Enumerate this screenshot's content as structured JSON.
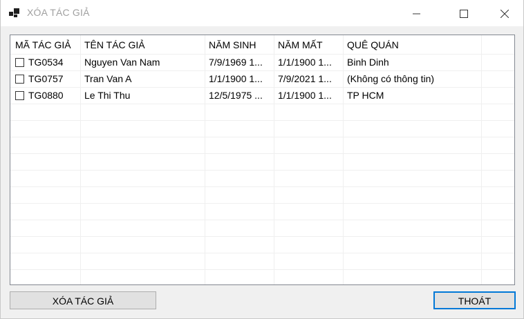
{
  "window": {
    "title": "XÓA TÁC GIẢ"
  },
  "table": {
    "headers": [
      "MÃ TÁC GIẢ",
      "TÊN TÁC GIẢ",
      "NĂM SINH",
      "NĂM MẤT",
      "QUÊ QUÁN"
    ],
    "rows": [
      {
        "checked": false,
        "id": "TG0534",
        "name": "Nguyen Van Nam",
        "birth": "7/9/1969 1...",
        "death": "1/1/1900 1...",
        "hometown": "Binh Dinh"
      },
      {
        "checked": false,
        "id": "TG0757",
        "name": "Tran Van A",
        "birth": "1/1/1900 1...",
        "death": "7/9/2021 1...",
        "hometown": "(Không có thông tin)"
      },
      {
        "checked": false,
        "id": "TG0880",
        "name": "Le Thi Thu",
        "birth": "12/5/1975 ...",
        "death": "1/1/1900 1...",
        "hometown": "TP HCM"
      }
    ]
  },
  "buttons": {
    "delete_label": "XÓA TÁC GIẢ",
    "exit_label": "THOÁT"
  },
  "colors": {
    "accent": "#0078d7",
    "title_text": "#a0a0a0"
  }
}
